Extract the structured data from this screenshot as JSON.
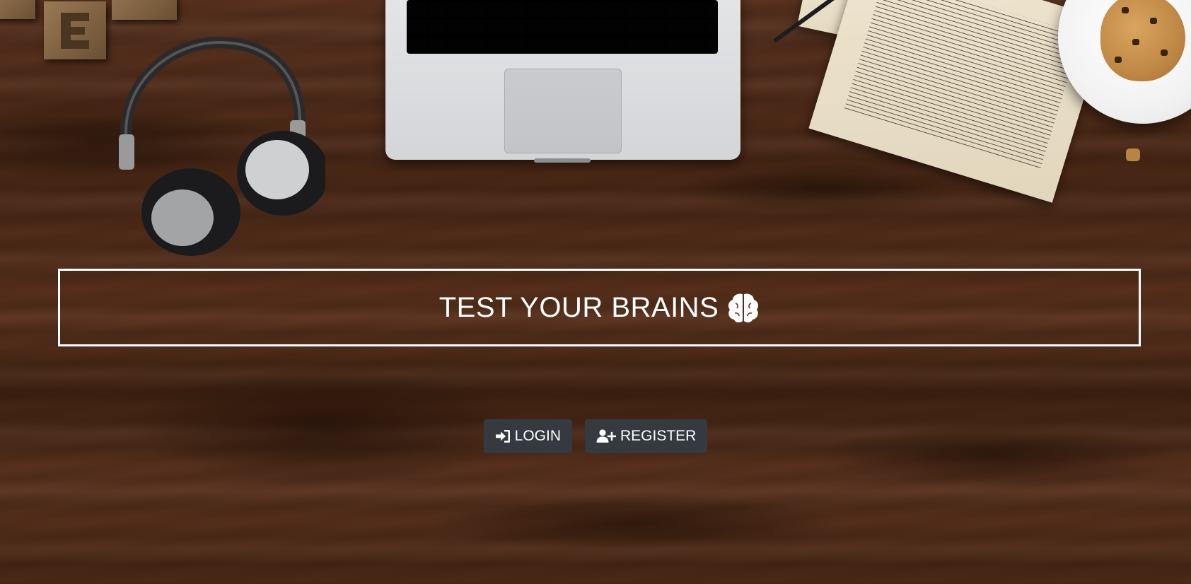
{
  "banner": {
    "title": "TEST YOUR BRAINS",
    "icon": "brain-icon"
  },
  "actions": {
    "login": {
      "label": "LOGIN",
      "icon": "sign-in-icon"
    },
    "register": {
      "label": "REGISTER",
      "icon": "user-plus-icon"
    }
  },
  "colors": {
    "button_bg": "#343a40",
    "banner_border": "#ffffff",
    "text": "#ffffff"
  },
  "background": {
    "description_icons": [
      "headphones-icon",
      "laptop-icon",
      "sheet-music-icon",
      "cookie-plate-icon",
      "pencil-icon",
      "letter-blocks-icon"
    ]
  }
}
